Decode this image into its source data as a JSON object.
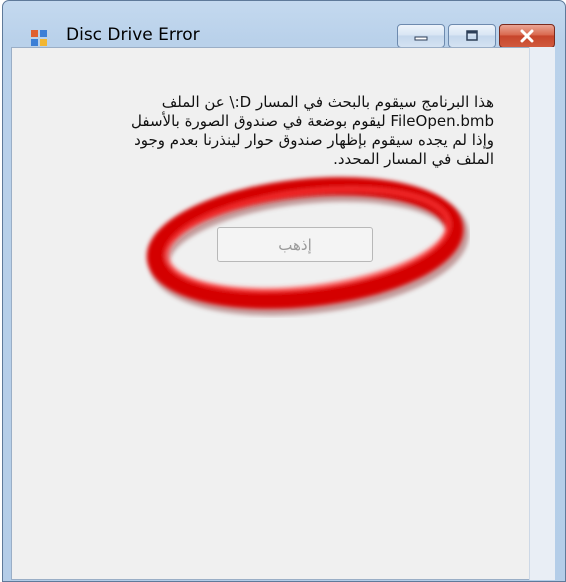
{
  "window": {
    "title": "Disc Drive Error"
  },
  "icons": {
    "app": "application-icon",
    "minimize": "minimize-icon",
    "maximize": "maximize-icon",
    "close": "close-icon"
  },
  "dialog": {
    "message": "هذا البرنامج سيقوم بالبحث في المسار D:\\ عن الملف FileOpen.bmb ليقوم بوضعة في صندوق الصورة بالأسفل وإذا لم يجده سيقوم بإظهار صندوق حوار لينذرنا بعدم وجود الملف في المسار المحدد.",
    "button_label": "إذهب"
  },
  "colors": {
    "annotation_ring": "#d40000"
  }
}
